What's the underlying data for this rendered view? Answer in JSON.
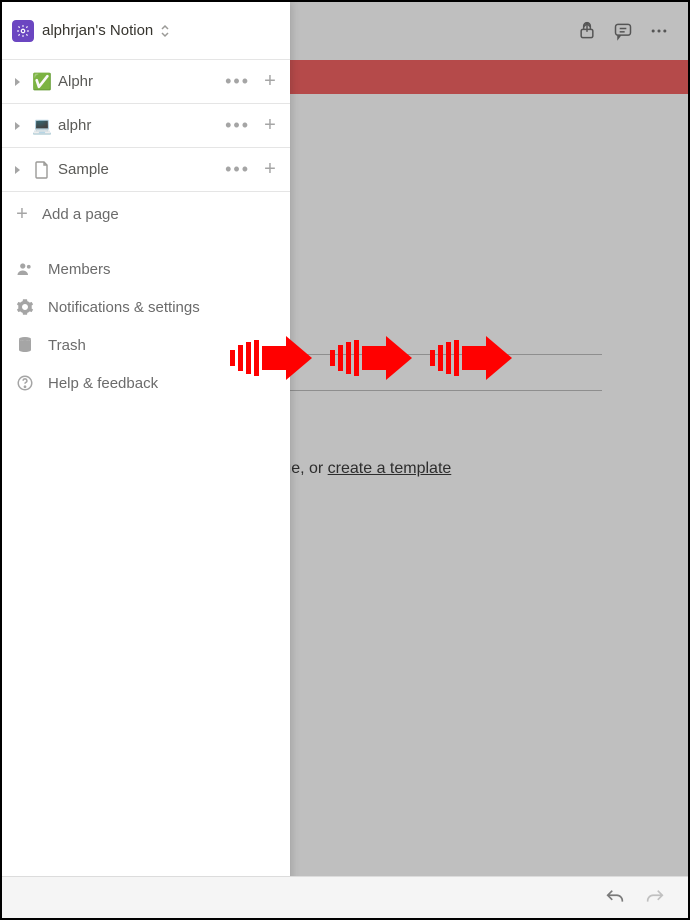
{
  "workspace": {
    "name": "alphrjan's Notion"
  },
  "pages": [
    {
      "icon": "✅",
      "label": "Alphr"
    },
    {
      "icon": "💻",
      "label": "alphr"
    },
    {
      "icon": "page",
      "label": "Sample"
    }
  ],
  "add_page_label": "Add a page",
  "menu": {
    "members": "Members",
    "notifications": "Notifications & settings",
    "trash": "Trash",
    "help": "Help & feedback"
  },
  "main": {
    "hint_prefix": "pty page, or ",
    "hint_link": "create a template"
  }
}
